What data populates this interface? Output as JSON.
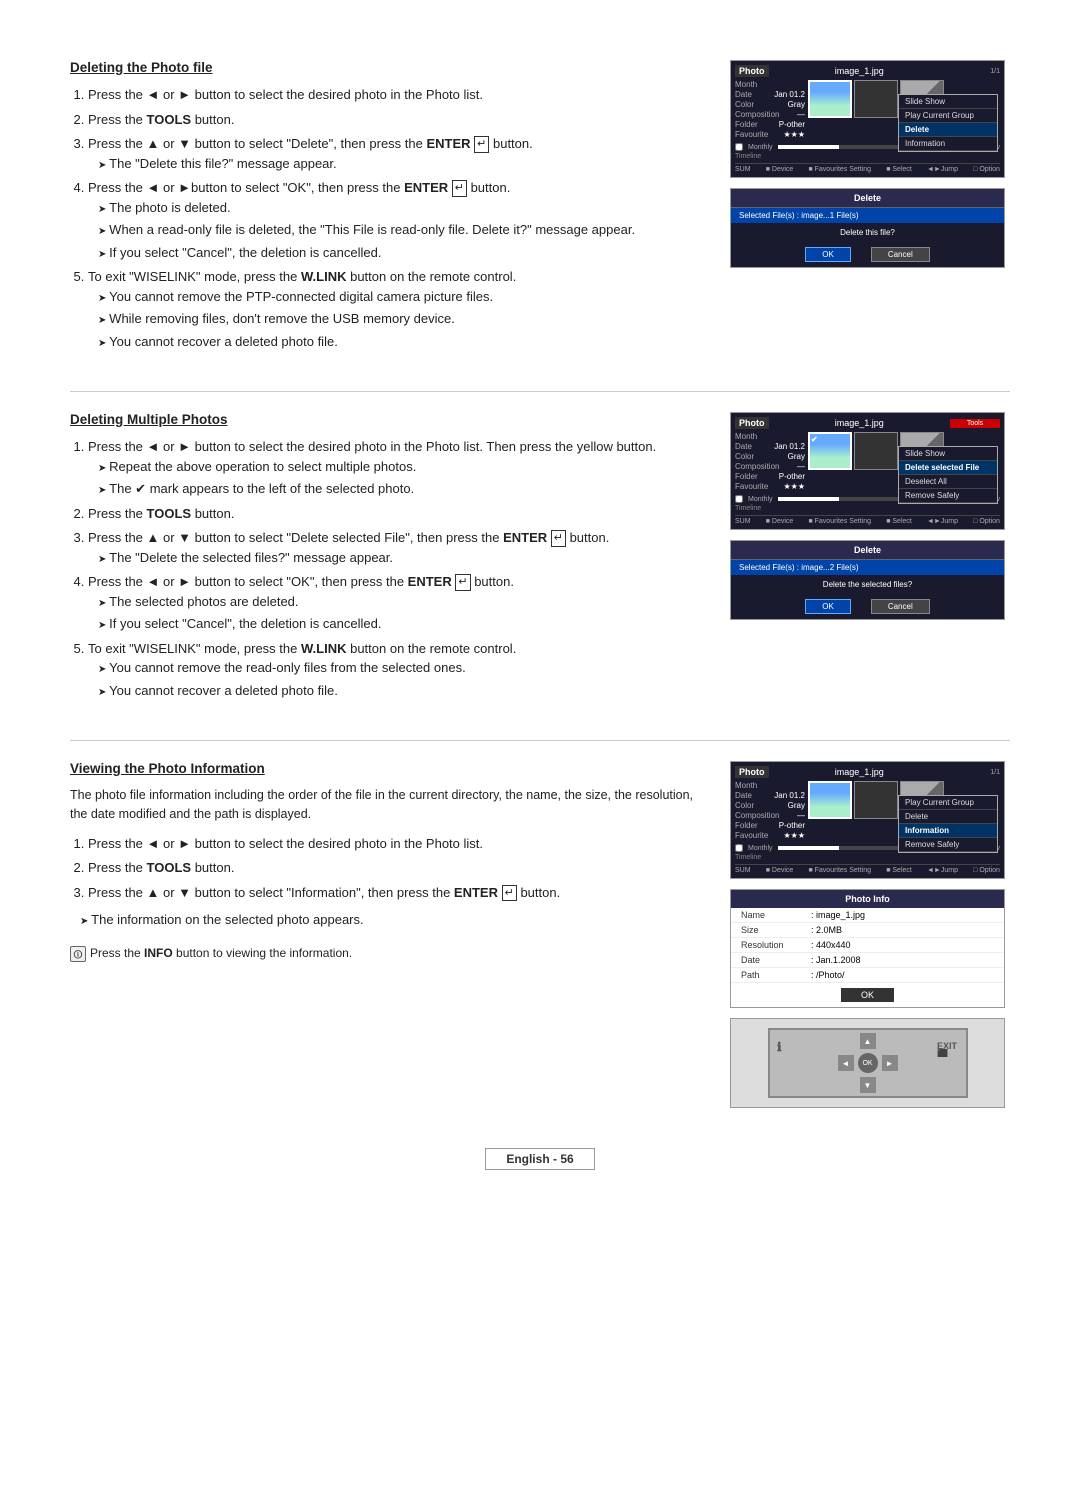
{
  "sections": {
    "delete_photo_file": {
      "heading": "Deleting the Photo file",
      "steps": [
        {
          "num": "1.",
          "text": "Press the ◄ or ► button to select the desired photo in the Photo list."
        },
        {
          "num": "2.",
          "text": "Press the TOOLS button."
        },
        {
          "num": "3.",
          "text": "Press the ▲ or ▼ button to select \"Delete\", then press the ENTER ↵ button."
        },
        {
          "num": "4.",
          "text": "Press the ◄ or ►button to select \"OK\", then press the ENTER ↵ button."
        },
        {
          "num": "5.",
          "text": "To exit \"WISELINK\" mode, press the W.LINK button on the remote control."
        }
      ],
      "notes_3": [
        "The \"Delete this file?\" message appear."
      ],
      "notes_4": [
        "The photo is deleted.",
        "When a read-only file is deleted, the \"This File is read-only file. Delete it?\" message appear.",
        "If you select \"Cancel\", the deletion is cancelled."
      ],
      "notes_5": [
        "You cannot remove the PTP-connected digital camera picture files.",
        "While removing files, don't remove the USB memory device.",
        "You cannot recover a deleted photo file."
      ]
    },
    "delete_multiple": {
      "heading": "Deleting Multiple Photos",
      "steps": [
        {
          "num": "1.",
          "text": "Press the ◄ or ► button to select the desired photo in the Photo list. Then press the yellow button."
        },
        {
          "num": "2.",
          "text": "Press the TOOLS button."
        },
        {
          "num": "3.",
          "text": "Press the ▲ or ▼ button to select \"Delete selected File\", then press the ENTER ↵ button."
        },
        {
          "num": "4.",
          "text": "Press the ◄ or ► button to select \"OK\", then press the ENTER ↵ button."
        },
        {
          "num": "5.",
          "text": "To exit \"WISELINK\" mode, press the W.LINK button on the remote control."
        }
      ],
      "notes_1": [
        "Repeat the above operation to select multiple photos.",
        "The ✔ mark appears to the left of the selected photo."
      ],
      "notes_3": [
        "The \"Delete the selected files?\" message appear."
      ],
      "notes_4": [
        "The selected photos are deleted.",
        "If you select \"Cancel\", the deletion is cancelled."
      ],
      "notes_5": [
        "You cannot remove the read-only files from the selected ones.",
        "You cannot recover a deleted photo file."
      ]
    },
    "view_photo_info": {
      "heading": "Viewing the Photo Information",
      "intro": "The photo file information including the order of the file in the current directory, the name, the size, the resolution, the date modified and the path is displayed.",
      "steps": [
        {
          "num": "1.",
          "text": "Press the ◄ or ► button to select the desired photo in the Photo list."
        },
        {
          "num": "2.",
          "text": "Press the TOOLS button."
        },
        {
          "num": "3.",
          "text": "Press the ▲ or ▼ button to select \"Information\", then press the ENTER ↵ button."
        }
      ],
      "note_info": "The information on the selected photo appears.",
      "note_bottom": "Press the INFO button to viewing the information."
    }
  },
  "ui": {
    "photo_label": "Photo",
    "image_filename": "image_1.jpg",
    "menu_items_1": [
      {
        "label": "Slide Show",
        "highlighted": false
      },
      {
        "label": "Play Current Group",
        "highlighted": false
      },
      {
        "label": "Delete",
        "highlighted": true
      },
      {
        "label": "Information",
        "highlighted": false
      }
    ],
    "menu_items_2": [
      {
        "label": "Slide Show",
        "highlighted": false
      },
      {
        "label": "Delete selected File",
        "highlighted": true
      },
      {
        "label": "Deselect All",
        "highlighted": false
      },
      {
        "label": "Remove Safely",
        "highlighted": false
      }
    ],
    "menu_items_3": [
      {
        "label": "Play Current Group",
        "highlighted": false
      },
      {
        "label": "Delete",
        "highlighted": false
      },
      {
        "label": "Information",
        "highlighted": true
      },
      {
        "label": "Remove Safely",
        "highlighted": false
      }
    ],
    "delete_dialog_1": {
      "title": "Delete",
      "selected": "Selected File(s) : image...1 File(s)",
      "message": "Delete this file?",
      "ok": "OK",
      "cancel": "Cancel"
    },
    "delete_dialog_2": {
      "title": "Delete",
      "selected": "Selected File(s) : image...2 File(s)",
      "message": "Delete the selected files?",
      "ok": "OK",
      "cancel": "Cancel"
    },
    "photo_info": {
      "title": "Photo Info",
      "name_label": "Name",
      "name_val": ": image_1.jpg",
      "size_label": "Size",
      "size_val": ": 2.0MB",
      "resolution_label": "Resolution",
      "resolution_val": ": 440x440",
      "date_label": "Date",
      "date_val": ": Jan.1.2008",
      "path_label": "Path",
      "path_val": ": /Photo/",
      "ok": "OK"
    },
    "sum_label": "SUM",
    "device_label": "■ Device",
    "fav_label": "■ Favourites Setting",
    "select_label": "■ Select",
    "jump_label": "◄►Jump",
    "option_label": "□ Option",
    "preference_monthly": "Monthly",
    "info_fields": {
      "month_label": "Month",
      "date_label": "Date",
      "color_label": "Color",
      "composition_label": "Composition",
      "folder_label": "Folder",
      "favourite_label": "Favourite",
      "month_val": "Jan 01.2",
      "color_val": "Gray",
      "composition_val": "—",
      "folder_val": "P-other",
      "favourite_val": "★★★"
    }
  },
  "footer": {
    "text": "English - 56"
  }
}
